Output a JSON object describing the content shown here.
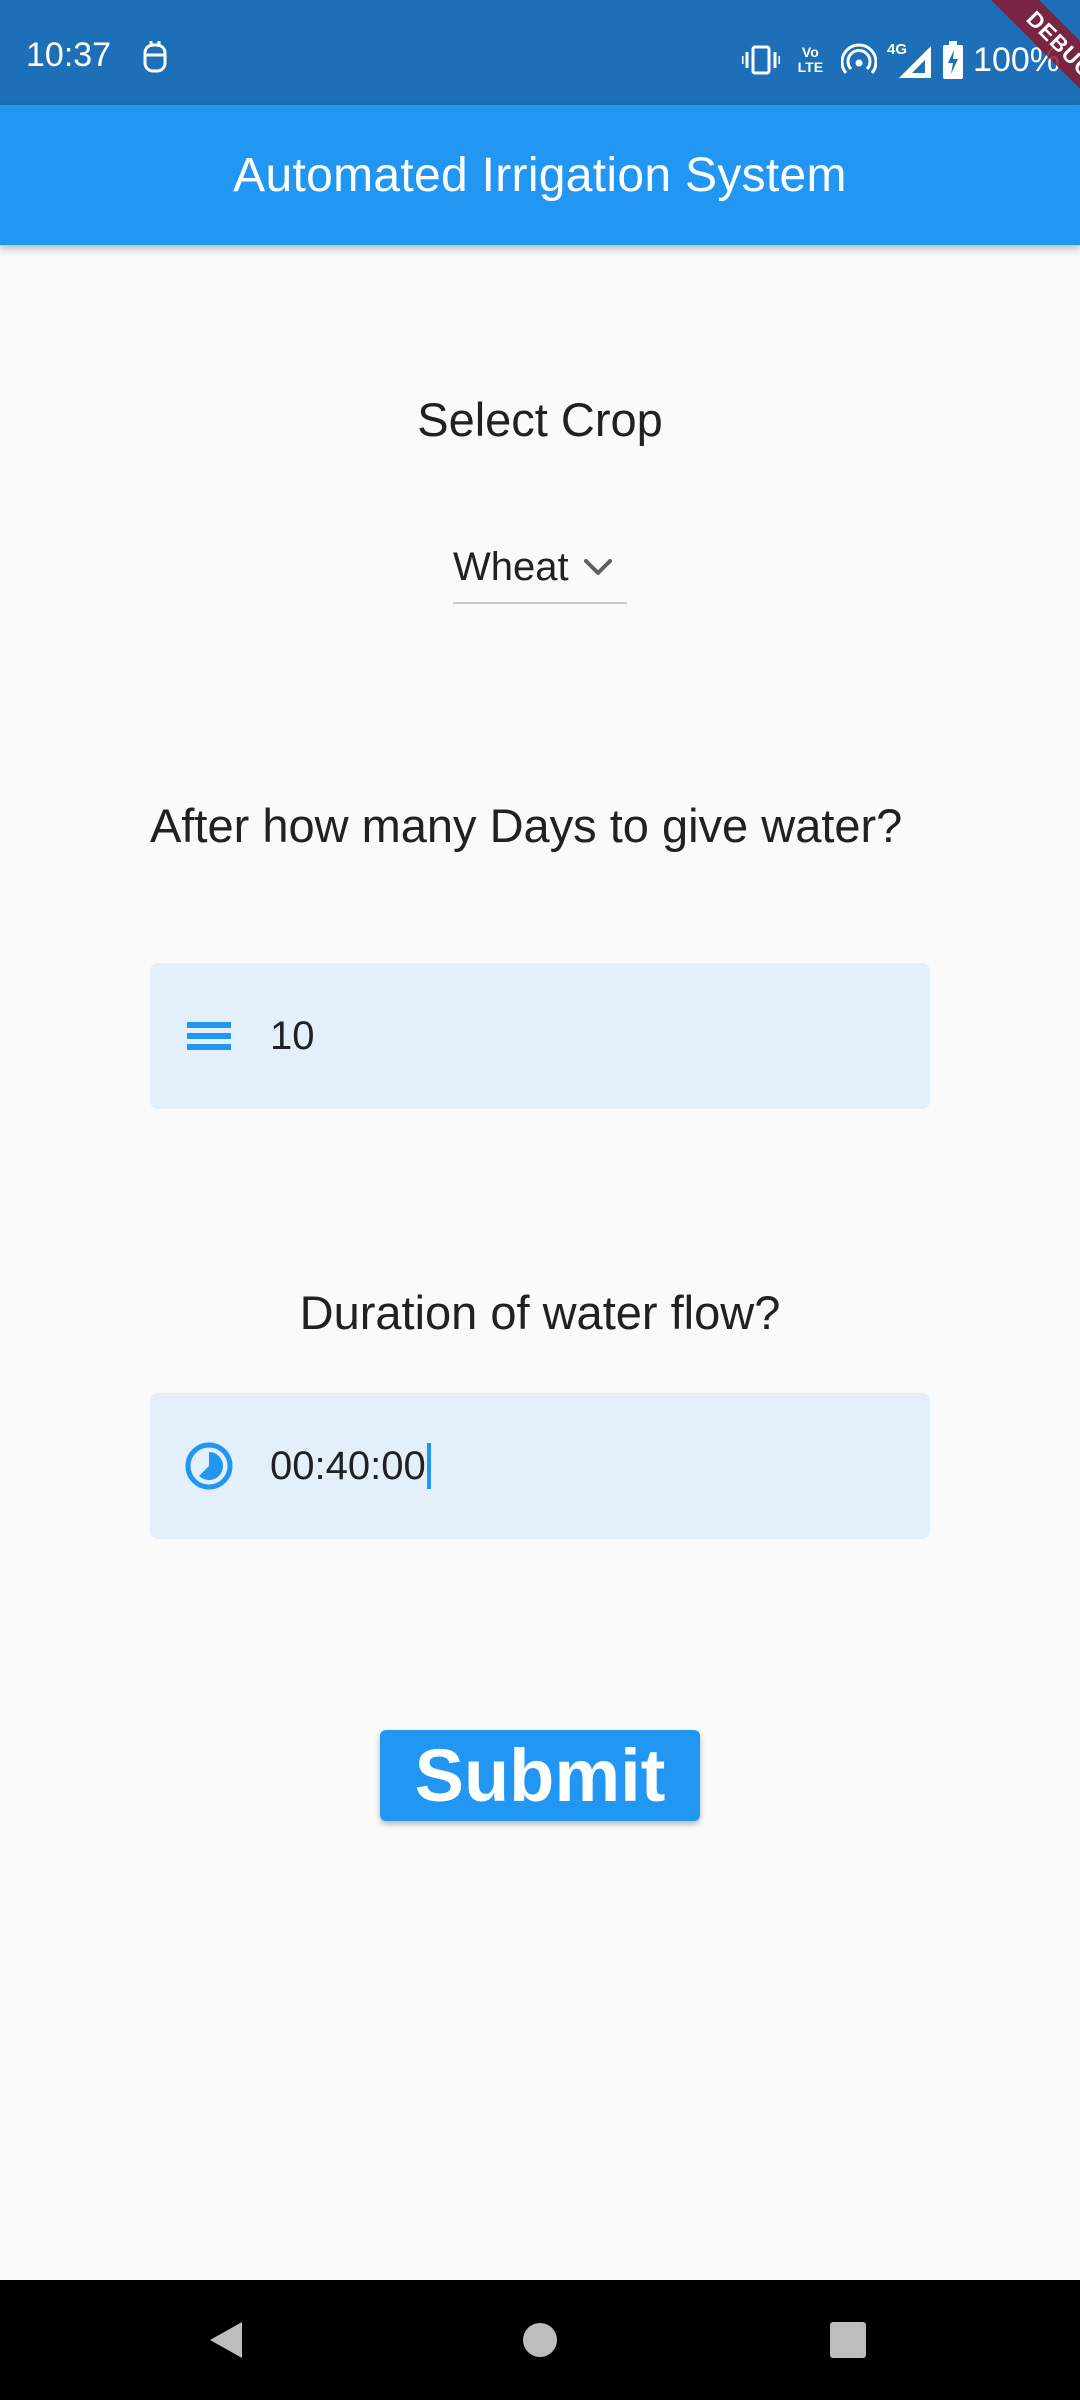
{
  "status_bar": {
    "time": "10:37",
    "network": "4G",
    "volte_line1": "Vo",
    "volte_line2": "LTE",
    "battery": "100%",
    "icons": [
      "app-notification-icon",
      "vibrate-icon",
      "volte-icon",
      "hotspot-icon",
      "signal-icon",
      "battery-icon"
    ],
    "debug_banner": "DEBUG"
  },
  "app_bar": {
    "title": "Automated Irrigation System"
  },
  "crop_section": {
    "label": "Select Crop",
    "selected": "Wheat",
    "icon": "chevron-down-icon"
  },
  "days_section": {
    "question": "After how many Days to give water?",
    "value": "10",
    "icon": "menu-lines-icon"
  },
  "duration_section": {
    "question": "Duration of water flow?",
    "value": "00:40:00",
    "icon": "timelapse-icon"
  },
  "submit": {
    "label": "Submit"
  },
  "nav_bar": {
    "icons": [
      "back-icon",
      "home-icon",
      "recents-icon"
    ]
  },
  "colors": {
    "primary": "#2196f3",
    "status_bar": "#1d6fb7",
    "input_fill": "#e3f0fb",
    "background": "#fafafa"
  }
}
